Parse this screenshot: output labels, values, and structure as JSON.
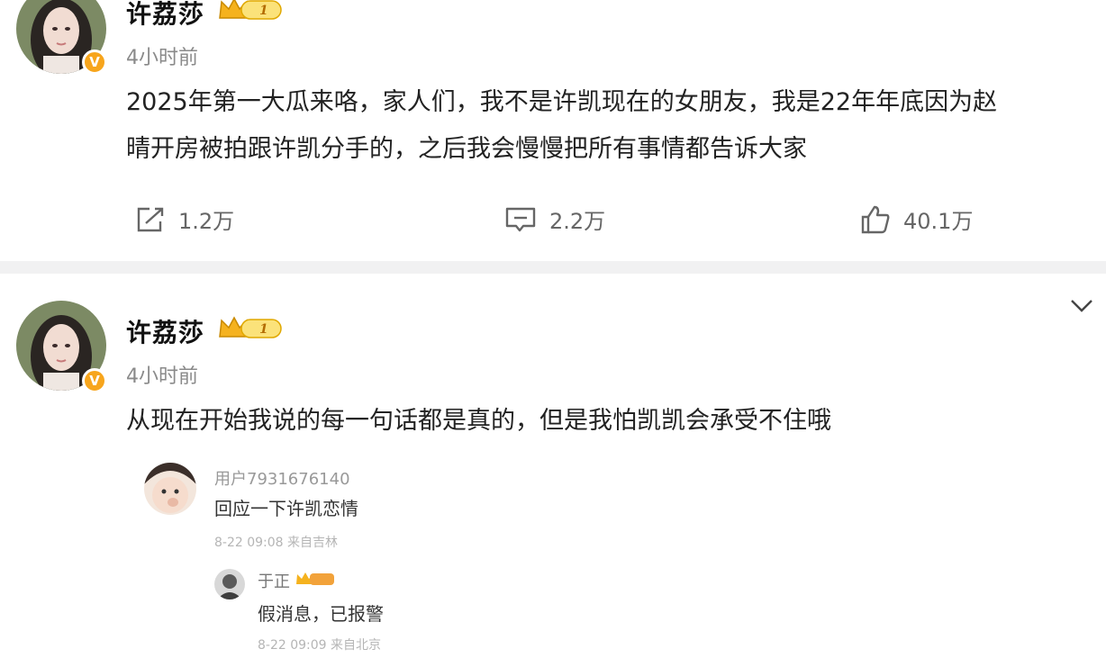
{
  "post1": {
    "username": "许荔莎",
    "level": "1",
    "time": "4小时前",
    "text_line1": "2025年第一大瓜来咯，家人们，我不是许凯现在的女朋友，我是22年年底因为赵",
    "text_line2": "晴开房被拍跟许凯分手的，之后我会慢慢把所有事情都告诉大家",
    "repost_count": "1.2万",
    "comment_count": "2.2万",
    "like_count": "40.1万"
  },
  "post2": {
    "username": "许荔莎",
    "level": "1",
    "time": "4小时前",
    "text": "从现在开始我说的每一句话都是真的，但是我怕凯凯会承受不住哦",
    "quoted_comment": {
      "user": "用户7931676140",
      "text": "回应一下许凯恋情",
      "meta": "8-22 09:08 来自吉林"
    },
    "quoted_reply": {
      "user": "于正",
      "text": "假消息，已报警",
      "meta": "8-22 09:09 来自北京"
    }
  },
  "icons": {
    "verified": "V",
    "accent": "#f7a51c"
  }
}
